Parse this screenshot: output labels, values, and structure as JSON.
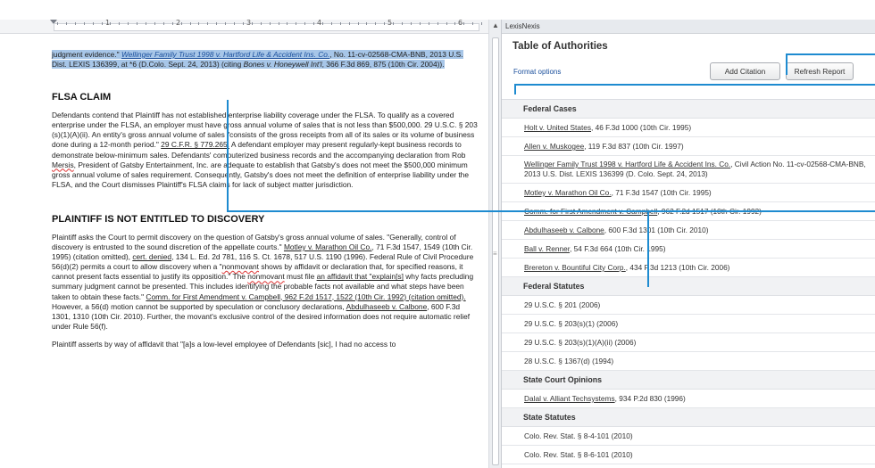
{
  "document": {
    "paragraph1": {
      "lead": "judgment evidence.\" ",
      "cite1": "Wellinger Family Trust 1998 v. Hartford Life & Accident Ins. Co.",
      "rest": ", No. 11-cv-02568-CMA-BNB, 2013 U.S. Dist. LEXIS 136399, at *6 (D.Colo. Sept. 24, 2013) (citing ",
      "cite2": "Bones v. Honeywell Int'l",
      "tail": ", 366 F.3d 869, 875 (10th Cir. 2004))."
    },
    "heading1": "FLSA CLAIM",
    "paragraph2": {
      "text1": "Defendants contend that Plaintiff has not established enterprise liability coverage under the FLSA. To qualify as a covered enterprise under the FLSA, an employer must have gross annual volume of sales that is not less than $500,000. 29 U.S.C. § 203 (s)(1)(A)(ii). An entity's gross annual volume of sales \"consists of the gross receipts from all of its sales or its volume of business done during a 12-month period.\" ",
      "cfr": "29 C.F.R. § 779.265.",
      "text2": " A defendant employer may present regularly-kept business records to demonstrate below-minimum sales. Defendants' computerized business records and the accompanying declaration from Rob ",
      "name": "Mersis",
      "text3": ", President of Gatsby Entertainment, Inc. are adequate to establish that Gatsby's does not meet the $500,000 minimum gross annual volume of sales requirement. Consequently, Gatsby's does not meet the definition of enterprise liability under the FLSA, and the Court dismisses Plaintiff's FLSA claims for lack of subject matter jurisdiction."
    },
    "heading2": "PLAINTIFF IS NOT ENTITLED TO DISCOVERY",
    "paragraph3": {
      "text1": "Plaintiff asks the Court to permit discovery on the question of Gatsby's gross annual volume of sales. \"Generally, control of discovery is entrusted to the sound discretion of the appellate courts.\" ",
      "cite1": "Motley v. Marathon Oil Co.",
      "text2": ", 71 F.3d 1547, 1549 (10th Cir. 1995) (citation omitted), ",
      "cert": "cert. denied",
      "text3": ", 134 L. Ed. 2d 781, 116 S. Ct. 1678, 517 U.S. 1190 (1996). Federal Rule of Civil Procedure 56(d)(2) permits a court to allow discovery when a \"",
      "nonmovant1": "nonmovant",
      "text4": " shows by affidavit or declaration that, for specified reasons, it cannot present facts essential to justify its opposition.\" The ",
      "nonmovant2": "nonmovant",
      "text5": " must file ",
      "affidavit": "an affidavit that \"explain[s]",
      "text6": " why facts precluding summary judgment cannot be presented. This includes identifying the probable facts not available and what steps have been taken to obtain these facts.\" ",
      "cite2": "Comm. for First Amendment v. Campbell, 962 F.2d 1517, 1522 (10th Cir. 1992) (citation omitted).",
      "text7": " However, a 56(d) motion cannot be supported by speculation or conclusory declarations, ",
      "cite3": "Abdulhaseeb v. Calbone",
      "text8": ", 600 F.3d 1301, 1310 (10th Cir. 2010). Further, the movant's exclusive control of the desired information does not require automatic relief under Rule 56(f)."
    },
    "paragraph4": "Plaintiff asserts by way of affidavit that \"[a]s a low-level employee of Defendants [sic], I had no access to"
  },
  "ruler": {
    "numbers": [
      "1",
      "2",
      "3",
      "4",
      "5",
      "6"
    ]
  },
  "lexis_pane": {
    "window_title": "LexisNexis",
    "title": "Table of Authorities",
    "format_options": "Format options",
    "add_citation": "Add Citation",
    "refresh_report": "Refresh Report",
    "sections": [
      {
        "header": "Federal Cases",
        "rows": [
          {
            "case": "Holt v. United States",
            "rest": ", 46 F.3d 1000 (10th Cir. 1995)"
          },
          {
            "case": "Allen v. Muskogee",
            "rest": ", 119 F.3d 837 (10th Cir. 1997)"
          },
          {
            "case": "Wellinger Family Trust 1998 v. Hartford Life & Accident Ins. Co.",
            "rest": ", Civil Action No. 11-cv-02568-CMA-BNB, 2013 U.S. Dist. LEXIS 136399 (D. Colo. Sept. 24, 2013)"
          },
          {
            "case": "Motley v. Marathon Oil Co.",
            "rest": ", 71 F.3d 1547 (10th Cir. 1995)"
          },
          {
            "case": "Comm. for First Amendment v. Campbell",
            "rest": ", 962 F.2d 1517 (10th Cir. 1992)"
          },
          {
            "case": "Abdulhaseeb v. Calbone",
            "rest": ", 600 F.3d 1301 (10th Cir. 2010)"
          },
          {
            "case": "Ball v. Renner",
            "rest": ", 54 F.3d 664 (10th Cir. 1995)"
          },
          {
            "case": "Brereton v. Bountiful City Corp.",
            "rest": ", 434 F.3d 1213 (10th Cir. 2006)"
          }
        ]
      },
      {
        "header": "Federal Statutes",
        "rows": [
          {
            "case": "",
            "rest": "29 U.S.C. § 201 (2006)"
          },
          {
            "case": "",
            "rest": "29 U.S.C. § 203(s)(1) (2006)"
          },
          {
            "case": "",
            "rest": "29 U.S.C. § 203(s)(1)(A)(ii) (2006)"
          },
          {
            "case": "",
            "rest": "28 U.S.C. § 1367(d) (1994)"
          }
        ]
      },
      {
        "header": "State Court Opinions",
        "rows": [
          {
            "case": "Dalal v. Alliant Techsystems",
            "rest": ", 934 P.2d 830 (1996)"
          }
        ]
      },
      {
        "header": "State Statutes",
        "rows": [
          {
            "case": "",
            "rest": "Colo. Rev. Stat. § 8-4-101 (2010)"
          },
          {
            "case": "",
            "rest": "Colo. Rev. Stat. § 8-6-101 (2010)"
          }
        ]
      }
    ]
  },
  "colors": {
    "callout": "#1e8bd0",
    "selection": "#a7c6e8",
    "link": "#1a4f9c"
  }
}
